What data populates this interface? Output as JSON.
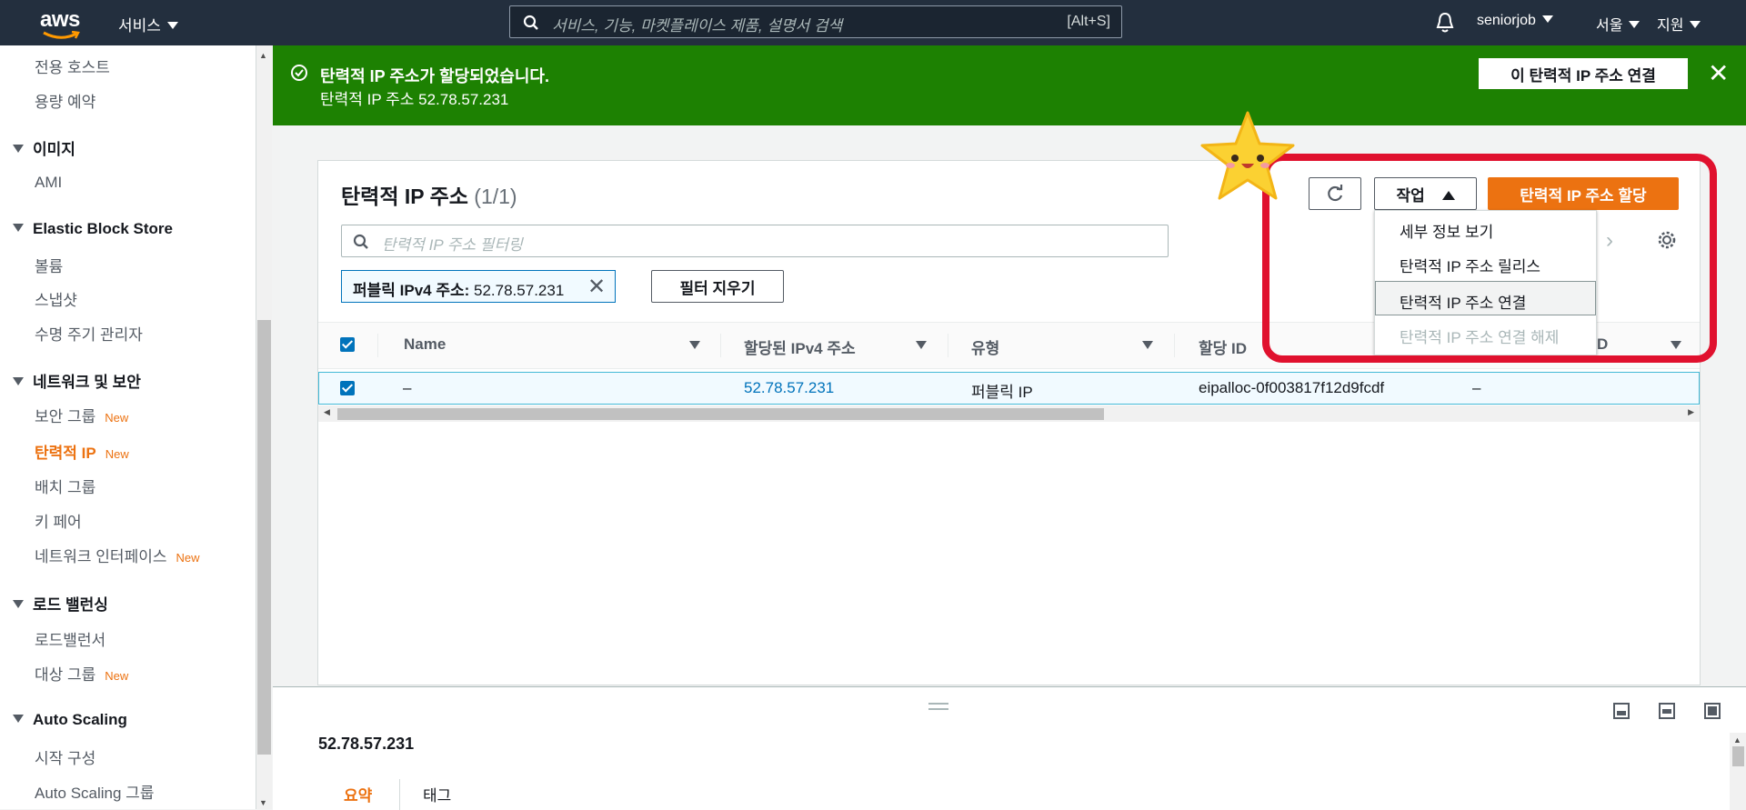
{
  "topbar": {
    "logo": "aws",
    "services": "서비스",
    "search_placeholder": "서비스, 기능, 마켓플레이스 제품, 설명서 검색",
    "search_shortcut": "[Alt+S]",
    "user": "seniorjob",
    "region": "서울",
    "support": "지원"
  },
  "sidebar": {
    "items": [
      {
        "label": "전용 호스트"
      },
      {
        "label": "용량 예약"
      }
    ],
    "images_header": "이미지",
    "ami": "AMI",
    "ebs_header": "Elastic Block Store",
    "volumes": "볼륨",
    "snapshots": "스냅샷",
    "lifecycle": "수명 주기 관리자",
    "network_header": "네트워크 및 보안",
    "security_groups": "보안 그룹",
    "elastic_ip": "탄력적 IP",
    "placement_groups": "배치 그룹",
    "key_pairs": "키 페어",
    "network_interfaces": "네트워크 인터페이스",
    "lb_header": "로드 밸런싱",
    "load_balancers": "로드밸런서",
    "target_groups": "대상 그룹",
    "as_header": "Auto Scaling",
    "launch_config": "시작 구성",
    "as_groups": "Auto Scaling 그룹",
    "new_badge": "New"
  },
  "banner": {
    "title": "탄력적 IP 주소가 할당되었습니다.",
    "subtitle": "탄력적 IP 주소 52.78.57.231",
    "action": "이 탄력적 IP 주소 연결",
    "color": "#1d8102"
  },
  "panel": {
    "title": "탄력적 IP 주소",
    "count": "(1/1)",
    "filter_placeholder": "탄력적 IP 주소 필터링",
    "chip_key": "퍼블릭 IPv4 주소:",
    "chip_value": "52.78.57.231",
    "clear_filters": "필터 지우기",
    "actions_label": "작업",
    "allocate_label": "탄력적 IP 주소 할당",
    "columns": [
      "Name",
      "할당된 IPv4 주소",
      "유형",
      "할당 ID",
      "D"
    ],
    "row": {
      "name": "–",
      "ipv4": "52.78.57.231",
      "type": "퍼블릭 IP",
      "allocation_id": "eipalloc-0f003817f12d9fcdf",
      "extra": "–"
    },
    "menu": [
      "세부 정보 보기",
      "탄력적 IP 주소 릴리스",
      "탄력적 IP 주소 연결",
      "탄력적 IP 주소 연결 해제"
    ]
  },
  "split": {
    "title": "52.78.57.231",
    "tabs": [
      "요약",
      "태그"
    ]
  },
  "colors": {
    "accent": "#ec7211",
    "link": "#0073bb",
    "highlight_box": "#e0112e"
  }
}
